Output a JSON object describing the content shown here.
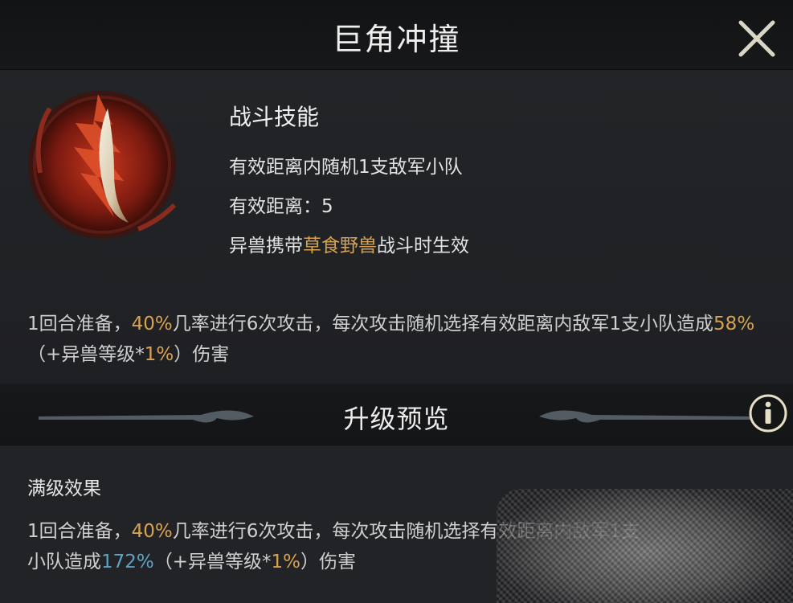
{
  "header": {
    "title": "巨角冲撞"
  },
  "skill": {
    "icon": "horn-icon",
    "type": "战斗技能",
    "target_text": "有效距离内随机1支敌军小队",
    "range_label": "有效距离：",
    "range_value": "5",
    "condition_pre": "异兽携带",
    "condition_highlight": "草食野兽",
    "condition_post": "战斗时生效"
  },
  "description": {
    "p1": "1回合准备，",
    "chance": "40%",
    "p2": "几率进行6次攻击，每次攻击随机选择有效距离内敌军1支小队造成",
    "damage": "58%",
    "p3": "（+异兽等级*",
    "scale": "1%",
    "p4": "）伤害"
  },
  "upgrade": {
    "title": "升级预览",
    "max_label": "满级效果",
    "p1": "1回合准备，",
    "chance": "40%",
    "p2": "几率进行6次攻击，每次攻击随机",
    "p2_obscured": "选择有效距离内敌军1支",
    "p2b": "小队造成",
    "damage": "172%",
    "p3": "（+异兽等级*",
    "scale": "1%",
    "p4": "）伤害"
  },
  "colors": {
    "highlight_gold": "#d8a351",
    "highlight_blue": "#5fa3c4",
    "background": "#1c1d20"
  },
  "icons": [
    "close-icon",
    "horn-icon",
    "info-icon",
    "wing-ornament-icon"
  ]
}
